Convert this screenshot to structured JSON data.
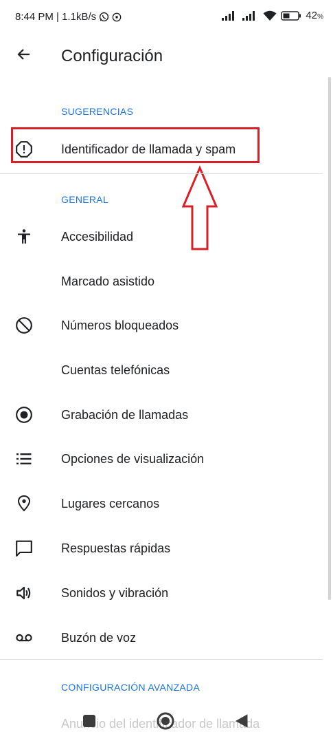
{
  "status": {
    "time_speed": "8:44 PM | 1.1kB/s",
    "battery": "42",
    "battery_unit": "%"
  },
  "header": {
    "title": "Configuración"
  },
  "sections": {
    "suggestions": "SUGERENCIAS",
    "general": "GENERAL",
    "advanced": "CONFIGURACIÓN AVANZADA"
  },
  "items": {
    "caller_id": "Identificador de llamada y spam",
    "accessibility": "Accesibilidad",
    "assisted_dialing": "Marcado asistido",
    "blocked_numbers": "Números bloqueados",
    "phone_accounts": "Cuentas telefónicas",
    "call_recording": "Grabación de llamadas",
    "display_options": "Opciones de visualización",
    "nearby_places": "Lugares cercanos",
    "quick_responses": "Respuestas rápidas",
    "sounds_vibration": "Sonidos y vibración",
    "voicemail": "Buzón de voz",
    "caller_id_announcement": "Anuncio del identificador de llamada"
  },
  "icons": {
    "caller_id": "alert-circle-icon",
    "accessibility": "accessibility-icon",
    "blocked_numbers": "block-icon",
    "call_recording": "record-icon",
    "display_options": "list-icon",
    "nearby_places": "location-pin-icon",
    "quick_responses": "chat-bubble-icon",
    "sounds_vibration": "volume-icon",
    "voicemail": "voicemail-icon"
  },
  "colors": {
    "accent": "#1a73e8",
    "highlight": "#d91f26",
    "text": "#202124"
  }
}
